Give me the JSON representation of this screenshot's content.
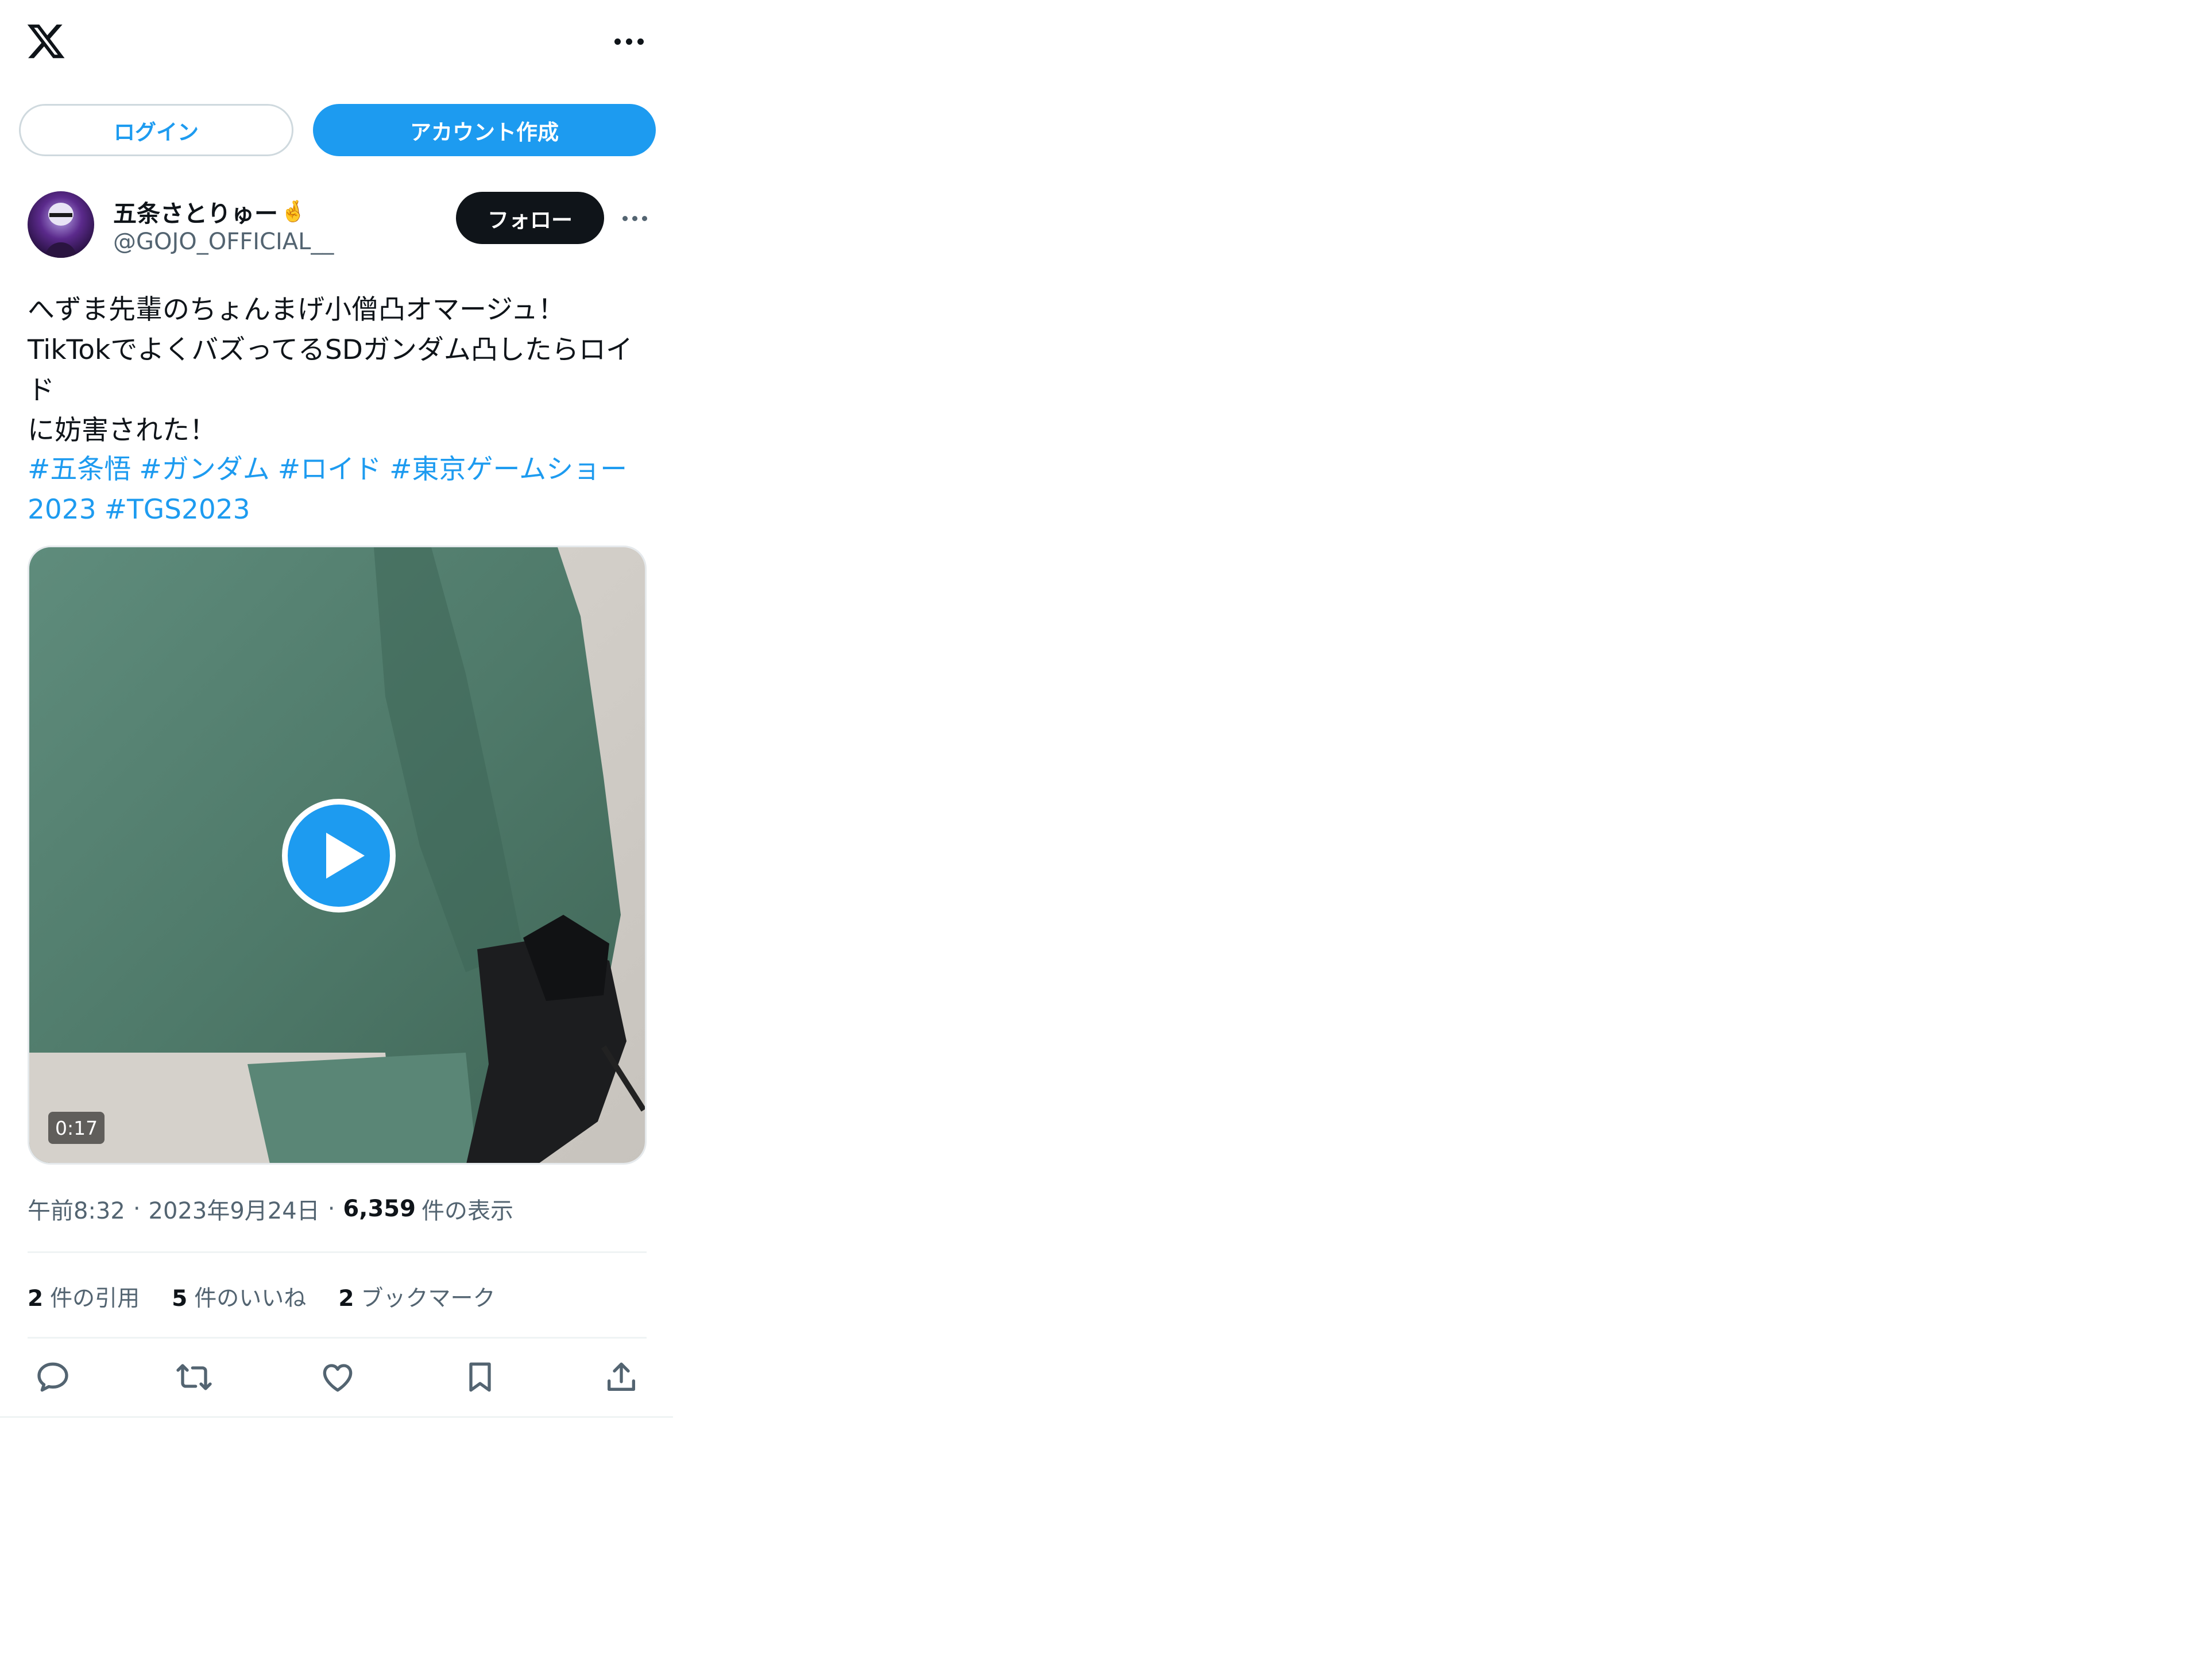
{
  "header": {
    "logo_icon": "x-logo-icon",
    "more_icon": "more-horizontal-icon"
  },
  "auth": {
    "login_label": "ログイン",
    "signup_label": "アカウント作成"
  },
  "author": {
    "display_name": "五条さとりゅー",
    "name_emoji": "🤞",
    "handle": "@GOJO_OFFICIAL__",
    "follow_label": "フォロー"
  },
  "tweet": {
    "text": "へずま先輩のちょんまげ小僧凸オマージュ！\nTikTokでよくバズってるSDガンダム凸したらロイド\nに妨害された！",
    "hashtags": [
      "#五条悟",
      "#ガンダム",
      "#ロイド",
      "#東京ゲームショー\n2023",
      "#TGS2023"
    ]
  },
  "media": {
    "duration": "0:17",
    "play_icon": "play-icon"
  },
  "meta": {
    "time": "午前8:32",
    "date": "2023年9月24日",
    "view_count": "6,359",
    "view_label": "件の表示",
    "separator": "·"
  },
  "stats": {
    "quotes_count": "2",
    "quotes_label": "件の引用",
    "likes_count": "5",
    "likes_label": "件のいいね",
    "bookmarks_count": "2",
    "bookmarks_label": "ブックマーク"
  },
  "actions": [
    "reply-icon",
    "retweet-icon",
    "like-icon",
    "bookmark-icon",
    "share-icon"
  ],
  "colors": {
    "accent": "#1d9bf0",
    "text": "#0f1419",
    "secondary": "#536471",
    "border": "#cfd9de"
  }
}
